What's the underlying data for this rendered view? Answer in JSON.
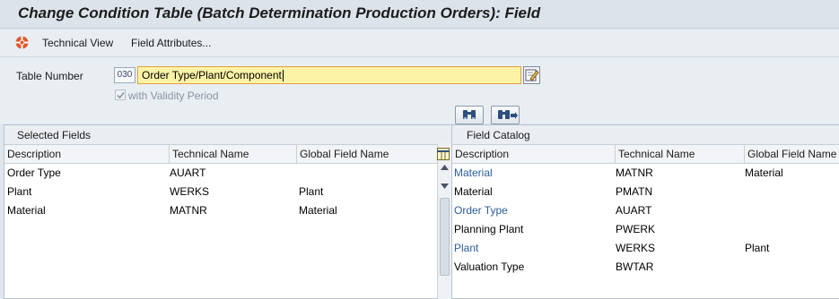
{
  "window": {
    "title": "Change Condition Table (Batch Determination Production Orders): Field"
  },
  "toolbar": {
    "technical_view": "Technical View",
    "field_attributes": "Field Attributes..."
  },
  "form": {
    "table_number_label": "Table Number",
    "table_number_value": "030",
    "description_value": "Order Type/Plant/Component",
    "validity_label": "with Validity Period",
    "validity_checked": true
  },
  "selected_fields": {
    "title": "Selected Fields",
    "columns": [
      "Description",
      "Technical Name",
      "Global Field Name"
    ],
    "rows": [
      {
        "description": "Order Type",
        "technical": "AUART",
        "global": ""
      },
      {
        "description": "Plant",
        "technical": "WERKS",
        "global": "Plant"
      },
      {
        "description": "Material",
        "technical": "MATNR",
        "global": "Material"
      }
    ]
  },
  "field_catalog": {
    "title": "Field Catalog",
    "columns": [
      "Description",
      "Technical Name",
      "Global Field Name"
    ],
    "rows": [
      {
        "description": "Material",
        "technical": "MATNR",
        "global": "Material",
        "link": true
      },
      {
        "description": "Material",
        "technical": "PMATN",
        "global": "",
        "link": false
      },
      {
        "description": "Order Type",
        "technical": "AUART",
        "global": "",
        "link": true
      },
      {
        "description": "Planning Plant",
        "technical": "PWERK",
        "global": "",
        "link": false
      },
      {
        "description": "Plant",
        "technical": "WERKS",
        "global": "Plant",
        "link": true
      },
      {
        "description": "Valuation Type",
        "technical": "BWTAR",
        "global": "",
        "link": false
      }
    ]
  },
  "icons": {
    "toolbar_icon": "technical-view-icon",
    "find": "binoculars-icon",
    "find_next": "binoculars-next-icon",
    "edit": "edit-icon",
    "settings": "column-settings-icon",
    "check": "check-icon"
  },
  "colors": {
    "link": "#2b5d9c",
    "input_bg": "#fdf3a6",
    "input_border": "#e0a040",
    "page_bg": "#dfe6ee"
  }
}
